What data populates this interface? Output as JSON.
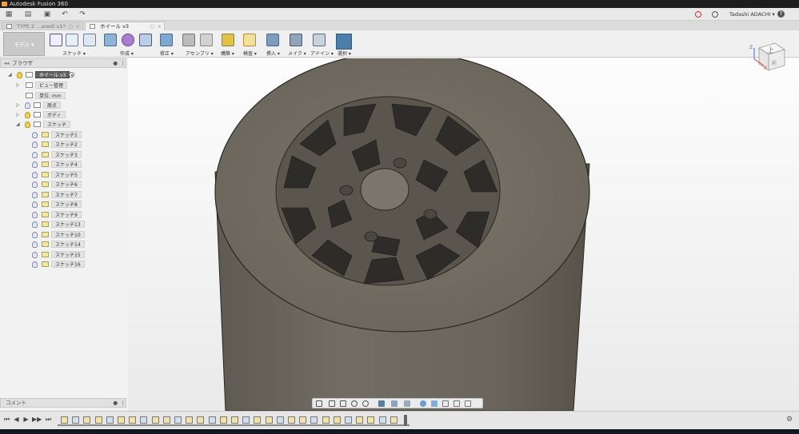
{
  "window": {
    "title": "Autodesk Fusion 360"
  },
  "appbar": {
    "user": "Tadashi ADACHI ▾",
    "help": "?"
  },
  "tabs": [
    {
      "label": "TYPE 2 ...ared) v1*",
      "active": false
    },
    {
      "label": "ホイール v3",
      "active": true
    }
  ],
  "ribbon": {
    "workspace": "モデル ▾",
    "groups": [
      "スケッチ ▾",
      "作成 ▾",
      "修正 ▾",
      "アセンブリ ▾",
      "構築 ▾",
      "検査 ▾",
      "挿入 ▾",
      "メイク ▾",
      "アドイン ▾",
      "選択 ▾"
    ]
  },
  "browser": {
    "title": "ブラウザ",
    "tree": [
      {
        "label": "ホイール v3",
        "level": 0,
        "root": true,
        "twisty": "◢"
      },
      {
        "label": "ビュー管理",
        "level": 1,
        "twisty": "▷",
        "icon": "folder"
      },
      {
        "label": "単位: mm",
        "level": 1,
        "twisty": "",
        "icon": "doc"
      },
      {
        "label": "原点",
        "level": 1,
        "twisty": "▷",
        "icon": "folder",
        "bulb": true
      },
      {
        "label": "ボディ",
        "level": 1,
        "twisty": "▷",
        "icon": "folder",
        "bulb": true
      },
      {
        "label": "スケッチ",
        "level": 1,
        "twisty": "◢",
        "icon": "folder",
        "bulb": true
      },
      {
        "label": "スケッチ1",
        "level": 2
      },
      {
        "label": "スケッチ2",
        "level": 2
      },
      {
        "label": "スケッチ3",
        "level": 2
      },
      {
        "label": "スケッチ4",
        "level": 2
      },
      {
        "label": "スケッチ5",
        "level": 2
      },
      {
        "label": "スケッチ6",
        "level": 2
      },
      {
        "label": "スケッチ7",
        "level": 2
      },
      {
        "label": "スケッチ8",
        "level": 2
      },
      {
        "label": "スケッチ9",
        "level": 2
      },
      {
        "label": "スケッチ13",
        "level": 2
      },
      {
        "label": "スケッチ10",
        "level": 2
      },
      {
        "label": "スケッチ14",
        "level": 2
      },
      {
        "label": "スケッチ15",
        "level": 2
      },
      {
        "label": "スケッチ16",
        "level": 2
      }
    ]
  },
  "comments": {
    "title": "コメント"
  },
  "viewcube": {
    "face": "上",
    "side": "前",
    "axis_x": "X",
    "axis_z": "Z"
  },
  "timeline": {
    "controls": [
      "⏮",
      "◀",
      "▶",
      "▶▶",
      "⏭"
    ],
    "item_count": 30
  },
  "colors": {
    "model": "#6f6a60",
    "model_dark": "#3f3b35",
    "accent": "#4d7ea8"
  }
}
